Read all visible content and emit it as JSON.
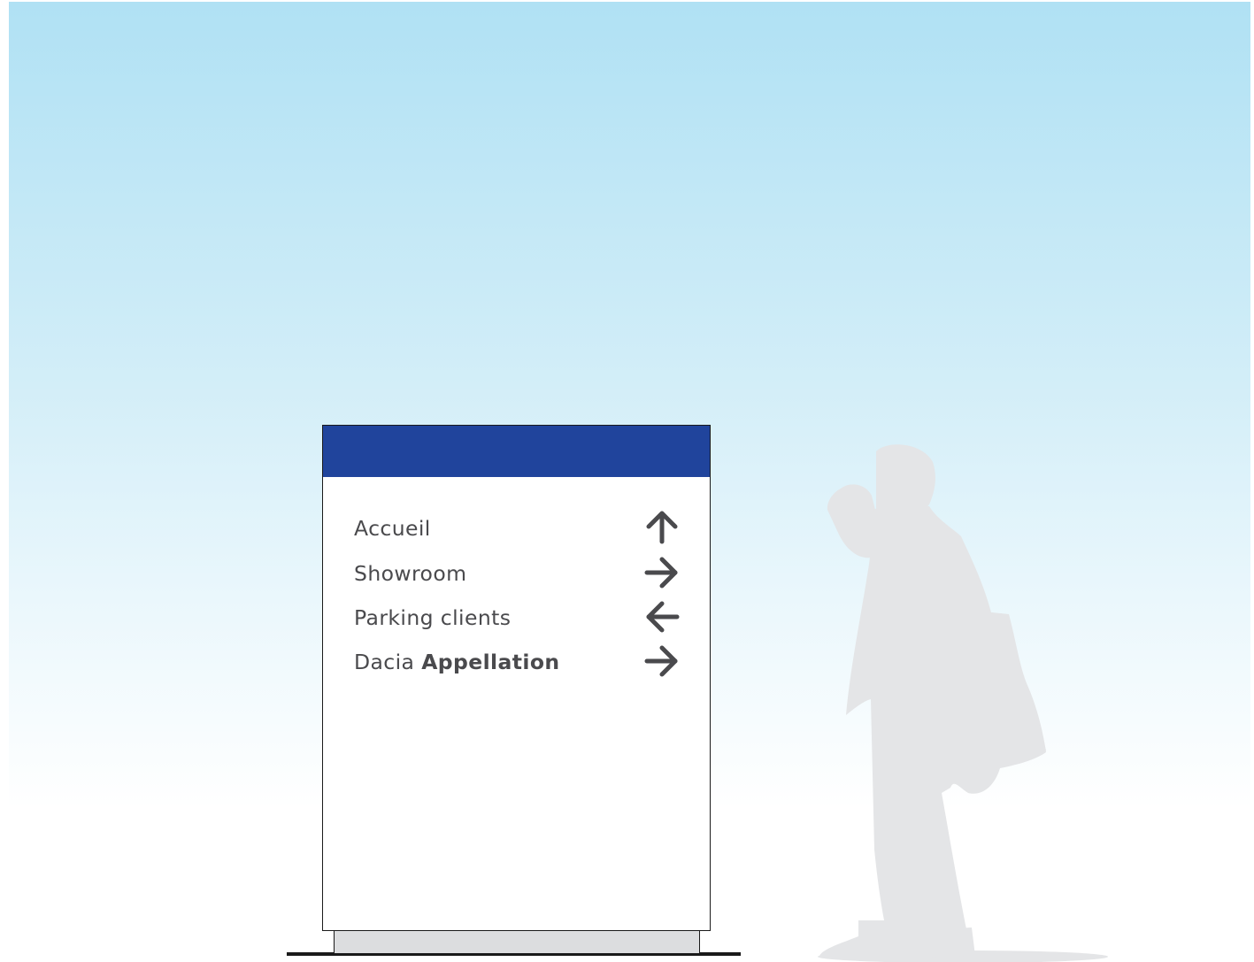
{
  "sign": {
    "header_color": "#20449c",
    "text_color": "#4a4a4d",
    "entries": [
      {
        "label": "Accueil",
        "label_bold": "",
        "arrow": "arrow-up-icon"
      },
      {
        "label": "Showroom",
        "label_bold": "",
        "arrow": "arrow-right-icon"
      },
      {
        "label": "Parking clients",
        "label_bold": "",
        "arrow": "arrow-left-icon"
      },
      {
        "label": "Dacia ",
        "label_bold": "Appellation",
        "arrow": "arrow-right-icon"
      }
    ]
  },
  "scene": {
    "sky_top_color": "#b0e1f4",
    "silhouette": "person-silhouette",
    "silhouette_color": "#e4e5e7"
  }
}
